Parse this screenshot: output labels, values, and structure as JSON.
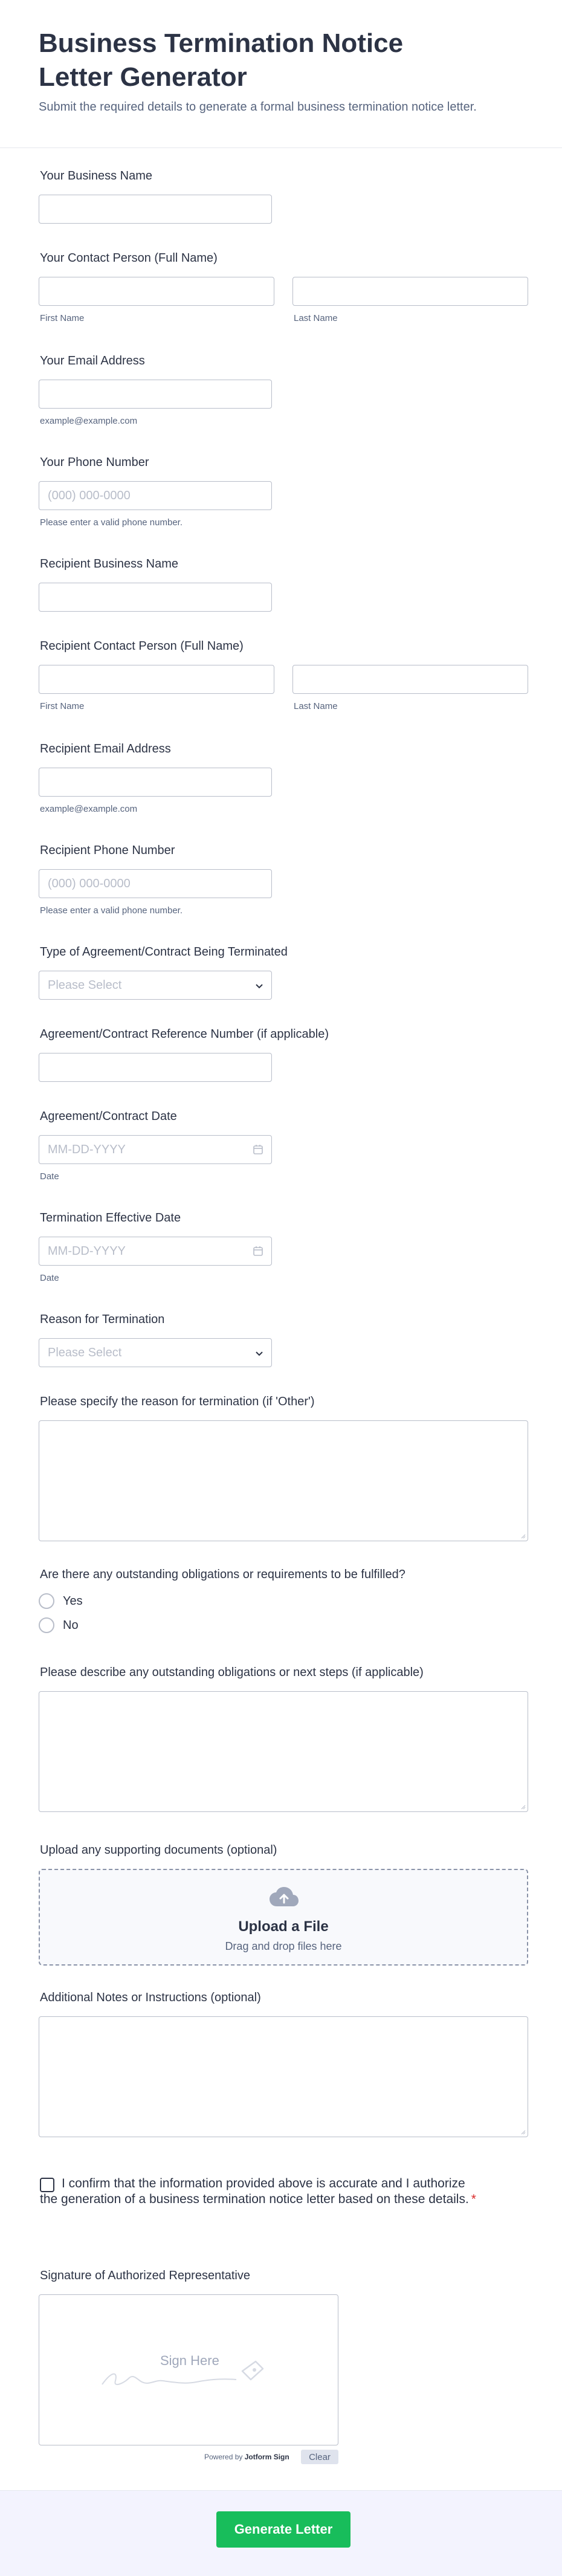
{
  "header": {
    "title": "Business Termination Notice Letter Generator",
    "subtitle": "Submit the required details to generate a formal business termination notice letter."
  },
  "fields": {
    "business_name": {
      "label": "Your Business Name"
    },
    "contact_person": {
      "label": "Your Contact Person (Full Name)",
      "first": "First Name",
      "last": "Last Name"
    },
    "email": {
      "label": "Your Email Address",
      "sub": "example@example.com"
    },
    "phone": {
      "label": "Your Phone Number",
      "placeholder": "(000) 000-0000",
      "sub": "Please enter a valid phone number."
    },
    "recipient_business": {
      "label": "Recipient Business Name"
    },
    "recipient_contact": {
      "label": "Recipient Contact Person (Full Name)",
      "first": "First Name",
      "last": "Last Name"
    },
    "recipient_email": {
      "label": "Recipient Email Address",
      "sub": "example@example.com"
    },
    "recipient_phone": {
      "label": "Recipient Phone Number",
      "placeholder": "(000) 000-0000",
      "sub": "Please enter a valid phone number."
    },
    "agreement_type": {
      "label": "Type of Agreement/Contract Being Terminated",
      "placeholder": "Please Select"
    },
    "agreement_ref": {
      "label": "Agreement/Contract Reference Number (if applicable)"
    },
    "agreement_date": {
      "label": "Agreement/Contract Date",
      "placeholder": "MM-DD-YYYY",
      "sub": "Date"
    },
    "effective_date": {
      "label": "Termination Effective Date",
      "placeholder": "MM-DD-YYYY",
      "sub": "Date"
    },
    "reason": {
      "label": "Reason for Termination",
      "placeholder": "Please Select"
    },
    "reason_other": {
      "label": "Please specify the reason for termination (if 'Other')"
    },
    "obligations": {
      "label": "Are there any outstanding obligations or requirements to be fulfilled?",
      "options": [
        "Yes",
        "No"
      ]
    },
    "obligations_desc": {
      "label": "Please describe any outstanding obligations or next steps (if applicable)"
    },
    "upload": {
      "label": "Upload any supporting documents (optional)",
      "title": "Upload a File",
      "sub": "Drag and drop files here"
    },
    "notes": {
      "label": "Additional Notes or Instructions (optional)"
    },
    "confirm": {
      "text": "I confirm that the information provided above is accurate and I authorize the generation of a business termination notice letter based on these details.",
      "required": "*"
    },
    "signature": {
      "label": "Signature of Authorized Representative",
      "placeholder": "Sign Here",
      "powered_prefix": "Powered by",
      "powered_brand": "Jotform Sign",
      "clear": "Clear"
    }
  },
  "submit": {
    "label": "Generate Letter"
  }
}
